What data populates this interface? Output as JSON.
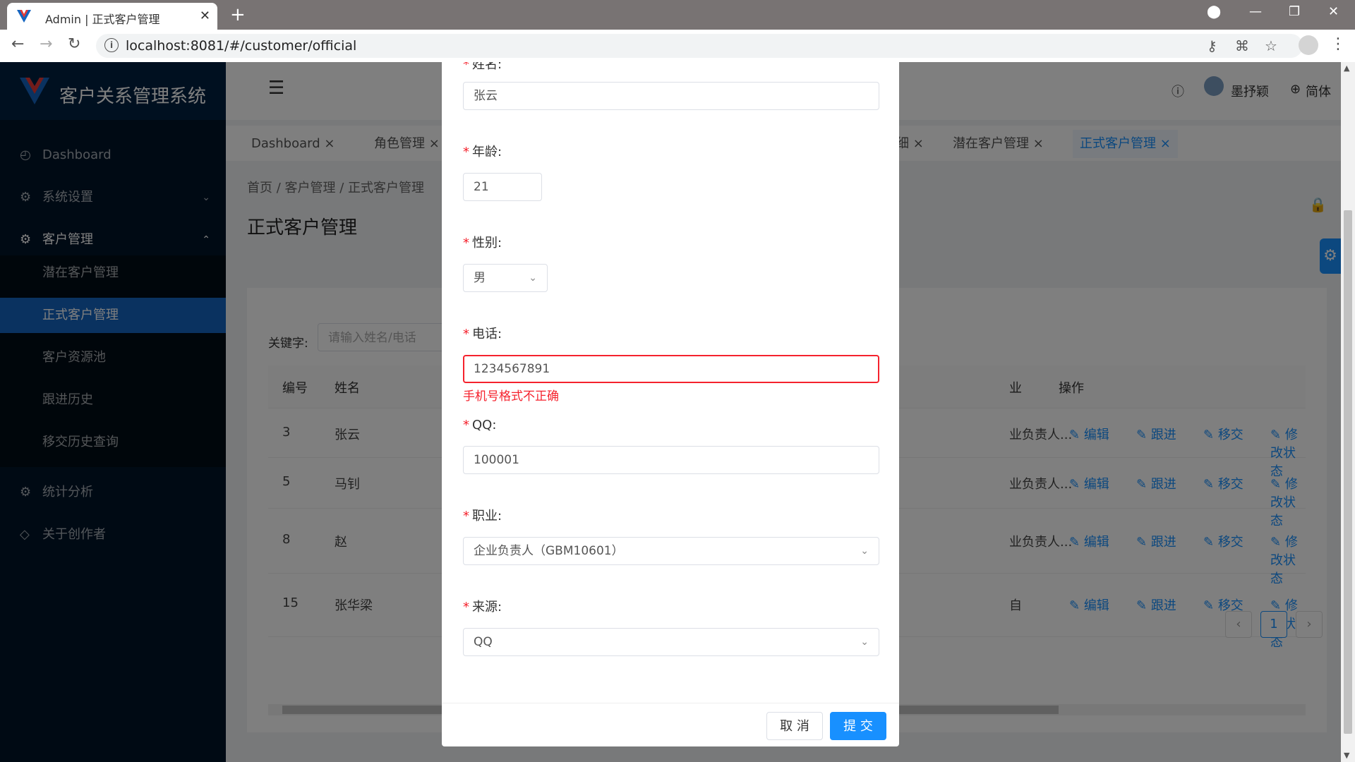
{
  "browser": {
    "tab_title": "Admin | 正式客户管理",
    "tab_close": "✕",
    "new_tab": "+",
    "url": "localhost:8081/#/customer/official"
  },
  "sidebar": {
    "brand_title": "客户关系管理系统",
    "items": [
      {
        "label": "Dashboard"
      },
      {
        "label": "系统设置",
        "arrow": "⌄"
      },
      {
        "label": "客户管理",
        "arrow": "⌃"
      },
      {
        "label": "统计分析"
      },
      {
        "label": "关于创作者"
      }
    ],
    "sub_items": [
      {
        "label": "潜在客户管理"
      },
      {
        "label": "正式客户管理"
      },
      {
        "label": "客户资源池"
      },
      {
        "label": "跟进历史"
      },
      {
        "label": "移交历史查询"
      }
    ]
  },
  "header": {
    "user_name": "墨抒颖",
    "language": "简体"
  },
  "tags": [
    {
      "label": "Dashboard ×"
    },
    {
      "label": "角色管理 ×"
    },
    {
      "label": "细 ×"
    },
    {
      "label": "潜在客户管理 ×"
    },
    {
      "label": "正式客户管理 ×"
    }
  ],
  "breadcrumb": "首页 / 客户管理 / 正式客户管理",
  "page_title": "正式客户管理",
  "search": {
    "label": "关键字:",
    "placeholder": "请输入姓名/电话"
  },
  "table": {
    "headers": {
      "id": "编号",
      "name": "姓名",
      "job": "业",
      "ops": "操作"
    },
    "rows": [
      {
        "id": "3",
        "name": "张云",
        "job": "业负责人..."
      },
      {
        "id": "5",
        "name": "马钊",
        "job": "业负责人..."
      },
      {
        "id": "8",
        "name": "赵",
        "job": "业负责人..."
      },
      {
        "id": "15",
        "name": "张华梁",
        "job": "自"
      }
    ],
    "ops": {
      "edit": "编辑",
      "follow": "跟进",
      "transfer": "移交",
      "status": "修改状态"
    }
  },
  "pagination": {
    "prev": "‹",
    "current": "1",
    "next": "›"
  },
  "modal": {
    "top_label": "姓名:",
    "name_value": "张云",
    "age_label": "年龄:",
    "age_value": "21",
    "gender_label": "性别:",
    "gender_value": "男",
    "phone_label": "电话:",
    "phone_value": "1234567891",
    "phone_error": "手机号格式不正确",
    "qq_label": "QQ:",
    "qq_value": "100001",
    "job_label": "职业:",
    "job_value": "企业负责人（GBM10601）",
    "source_label": "来源:",
    "source_value": "QQ",
    "required_mark": "*",
    "cancel_label": "取 消",
    "submit_label": "提 交"
  },
  "colors": {
    "primary": "#1890ff",
    "sidebar": "#001529",
    "error": "#f5222d",
    "active_menu": "#1565c0"
  }
}
